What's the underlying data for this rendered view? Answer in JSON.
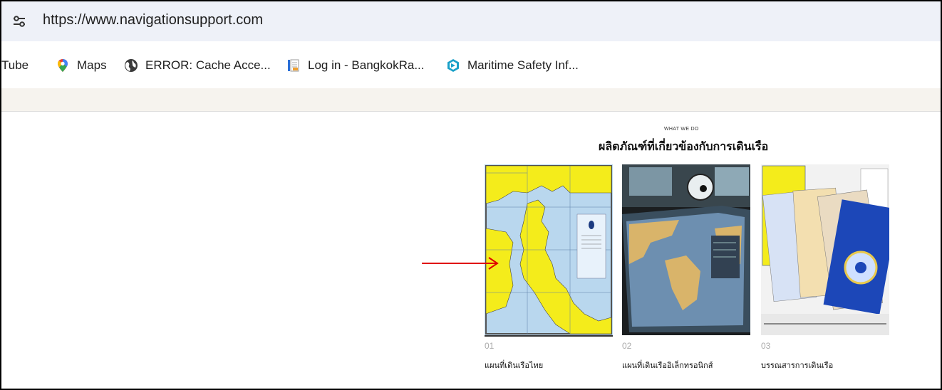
{
  "browser": {
    "url": "https://www.navigationsupport.com"
  },
  "bookmarks": [
    {
      "label": "Tube",
      "icon": "youtube-icon"
    },
    {
      "label": "Maps",
      "icon": "maps-pin-icon"
    },
    {
      "label": "ERROR: Cache Acce...",
      "icon": "globe-icon"
    },
    {
      "label": "Log in - BangkokRa...",
      "icon": "document-icon"
    },
    {
      "label": "Maritime Safety Inf...",
      "icon": "msi-icon"
    }
  ],
  "section": {
    "eyebrow": "WHAT WE DO",
    "heading": "ผลิตภัณฑ์ที่เกี่ยวข้องกับการเดินเรือ"
  },
  "products": [
    {
      "number": "01",
      "caption": "แผนที่เดินเรือไทย"
    },
    {
      "number": "02",
      "caption": "แผนที่เดินเรืออิเล็กทรอนิกส์"
    },
    {
      "number": "03",
      "caption": "บรรณสารการเดินเรือ"
    }
  ],
  "colors": {
    "address_bar": "#eef1f8",
    "annotation_arrow": "#e00000",
    "map_yellow": "#f4ec1b",
    "map_sea": "#b9d7ee"
  }
}
